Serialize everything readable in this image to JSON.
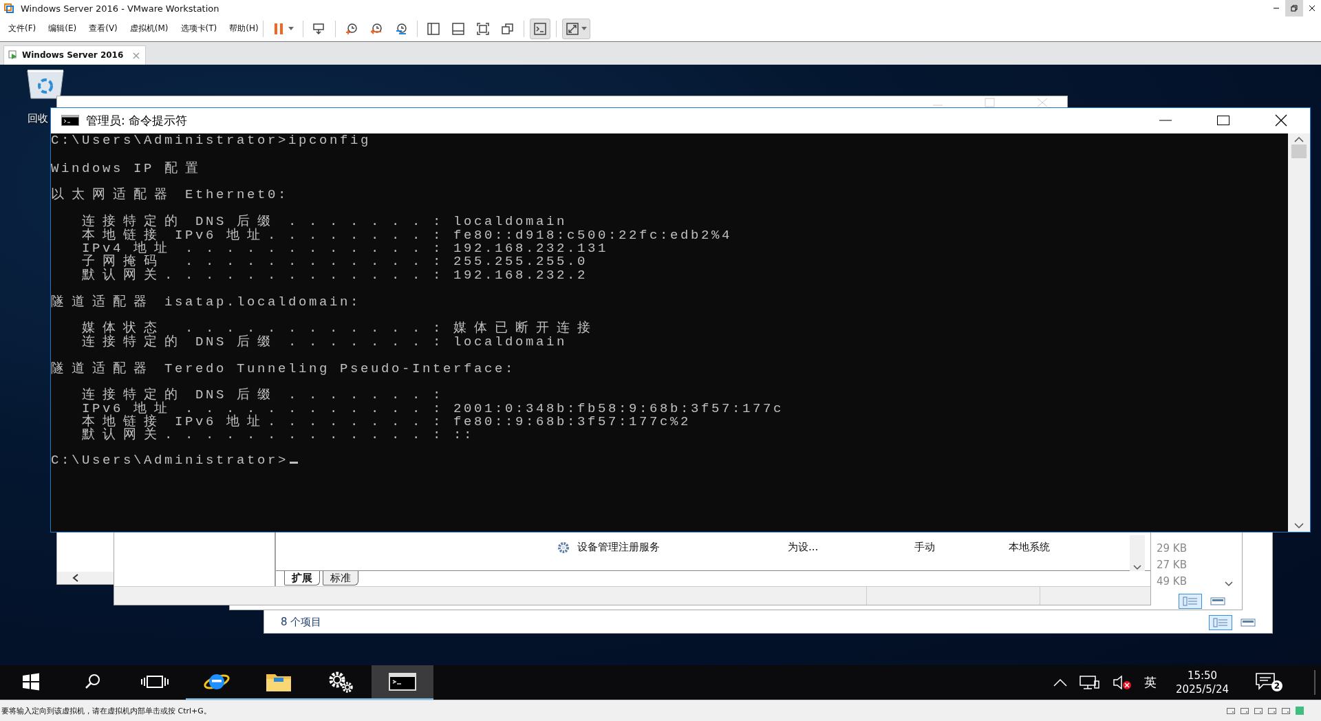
{
  "window": {
    "title": "Windows Server 2016 - VMware Workstation"
  },
  "menu": [
    "文件(F)",
    "编辑(E)",
    "查看(V)",
    "虚拟机(M)",
    "选项卡(T)",
    "帮助(H)"
  ],
  "toolbar_groups": [
    {
      "items": [
        {
          "kind": "pause",
          "pressed": false,
          "menu": true
        }
      ]
    },
    {
      "items": [
        {
          "kind": "send-keys",
          "pressed": false,
          "menu": false
        }
      ]
    },
    {
      "items": [
        {
          "kind": "snapshot",
          "pressed": false,
          "menu": false
        },
        {
          "kind": "revert",
          "pressed": false,
          "menu": false
        },
        {
          "kind": "manager",
          "pressed": false,
          "menu": false
        }
      ]
    },
    {
      "items": [
        {
          "kind": "sidebar",
          "pressed": false,
          "menu": false
        },
        {
          "kind": "thumbnails",
          "pressed": false,
          "menu": false
        },
        {
          "kind": "fit",
          "pressed": false,
          "menu": false
        },
        {
          "kind": "unity",
          "pressed": false,
          "menu": false
        }
      ]
    },
    {
      "items": [
        {
          "kind": "console",
          "pressed": true,
          "menu": false
        }
      ]
    },
    {
      "items": [
        {
          "kind": "stretch",
          "pressed": true,
          "menu": true
        }
      ]
    }
  ],
  "tabs": [
    {
      "label": "Windows Server 2016",
      "selected": true,
      "close": "×"
    }
  ],
  "desktop": {
    "icons": [
      {
        "label": "回收"
      }
    ]
  },
  "services_window": {
    "rows": [
      {
        "name": "设备管理注册服务",
        "description": "为设...",
        "startup": "手动",
        "logon": "本地系统"
      }
    ],
    "tabs": [
      {
        "label": "扩展",
        "selected": true
      },
      {
        "label": "标准",
        "selected": false
      }
    ]
  },
  "files_window": {
    "sizes": [
      "29 KB",
      "27 KB",
      "49 KB"
    ],
    "views": [
      {
        "kind": "details",
        "selected": true
      },
      {
        "kind": "tiles",
        "selected": false
      }
    ]
  },
  "folder_window": {
    "status": "8 个项目",
    "views": [
      {
        "kind": "details",
        "selected": true
      },
      {
        "kind": "tiles",
        "selected": false
      }
    ]
  },
  "cmd": {
    "title": "管理员: 命令提示符",
    "cursor": true,
    "blocks": [
      {
        "lines": [
          "C:\\Users\\Administrator>ipconfig"
        ]
      },
      {
        "lines": [
          "Windows IP 配置"
        ]
      },
      {
        "lines": [
          "以太网适配器 Ethernet0:"
        ]
      },
      {
        "lines": [
          "   连接特定的 DNS 后缀 . . . . . . . : localdomain",
          "   本地链接 IPv6 地址. . . . . . . . : fe80::d918:c500:22fc:edb2%4",
          "   IPv4 地址 . . . . . . . . . . . . : 192.168.232.131",
          "   子网掩码  . . . . . . . . . . . . : 255.255.255.0",
          "   默认网关. . . . . . . . . . . . . : 192.168.232.2"
        ]
      },
      {
        "lines": [
          "隧道适配器 isatap.localdomain:"
        ]
      },
      {
        "lines": [
          "   媒体状态  . . . . . . . . . . . . : 媒体已断开连接",
          "   连接特定的 DNS 后缀 . . . . . . . : localdomain"
        ]
      },
      {
        "lines": [
          "隧道适配器 Teredo Tunneling Pseudo-Interface:"
        ]
      },
      {
        "lines": [
          "   连接特定的 DNS 后缀 . . . . . . . :",
          "   IPv6 地址 . . . . . . . . . . . . : 2001:0:348b:fb58:9:68b:3f57:177c",
          "   本地链接 IPv6 地址. . . . . . . . : fe80::9:68b:3f57:177c%2",
          "   默认网关. . . . . . . . . . . . . : ::"
        ]
      },
      {
        "lines": [
          "C:\\Users\\Administrator>"
        ]
      }
    ]
  },
  "taskbar": {
    "apps": [
      {
        "kind": "start",
        "running": false,
        "selected": false
      },
      {
        "kind": "search",
        "running": false,
        "selected": false
      },
      {
        "kind": "task-view",
        "running": false,
        "selected": false
      },
      {
        "kind": "browser",
        "running": true,
        "selected": false
      },
      {
        "kind": "explorer",
        "running": true,
        "selected": false
      },
      {
        "kind": "settings",
        "running": true,
        "selected": false
      },
      {
        "kind": "terminal",
        "running": true,
        "selected": true
      }
    ],
    "tray": {
      "ime": "英",
      "time": "15:50",
      "date": "2025/5/24",
      "notifications": "2"
    }
  },
  "status_bar": {
    "hint": "要将输入定向到该虚拟机，请在虚拟机内部单击或按 Ctrl+G。"
  }
}
